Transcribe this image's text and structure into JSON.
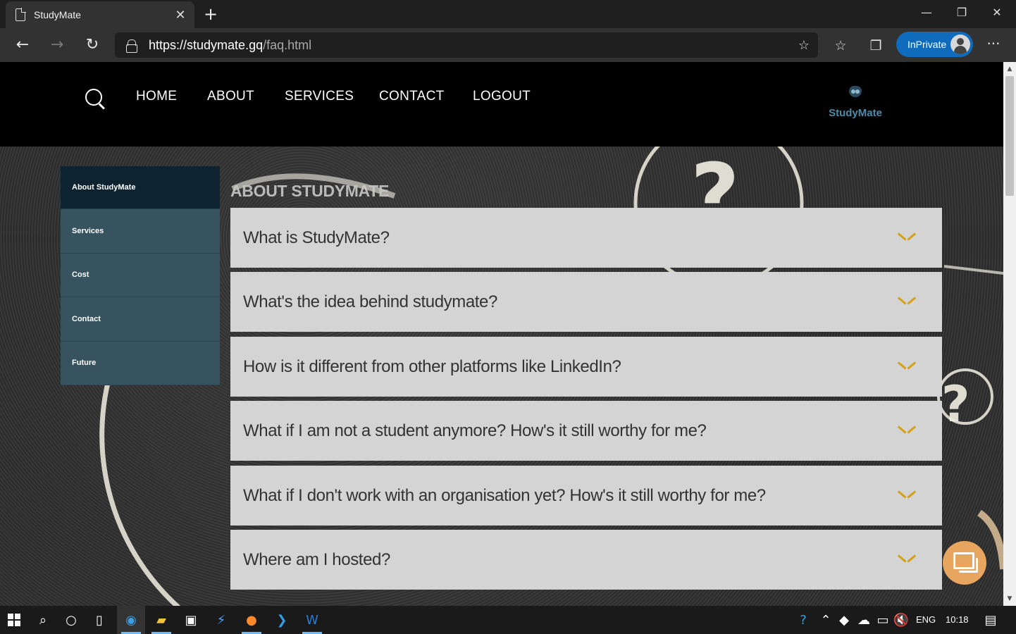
{
  "browser": {
    "tab_title": "StudyMate",
    "url_host": "https://studymate.gq",
    "url_path": "/faq.html",
    "inprivate_label": "InPrivate"
  },
  "header": {
    "nav": [
      "HOME",
      "ABOUT",
      "SERVICES",
      "CONTACT",
      "LOGOUT"
    ],
    "logo_text": "StudyMate"
  },
  "sidebar": {
    "items": [
      {
        "label": "About StudyMate",
        "active": true
      },
      {
        "label": "Services",
        "active": false
      },
      {
        "label": "Cost",
        "active": false
      },
      {
        "label": "Contact",
        "active": false
      },
      {
        "label": "Future",
        "active": false
      }
    ]
  },
  "main": {
    "section_title": "ABOUT STUDYMATE",
    "faqs": [
      "What is StudyMate?",
      "What's the idea behind studymate?",
      "How is it different from other platforms like LinkedIn?",
      "What if I am not a student anymore? How's it still worthy for me?",
      "What if I don't work with an organisation yet? How's it still worthy for me?",
      "Where am I hosted?"
    ]
  },
  "taskbar": {
    "lang": "ENG",
    "time": "10:18"
  },
  "colors": {
    "chevron": "#d4a21a",
    "sidebar_active": "#0d2330",
    "sidebar_item": "#36535f",
    "faq_bg": "#d4d4d4",
    "chat_button": "#e8a55f"
  }
}
